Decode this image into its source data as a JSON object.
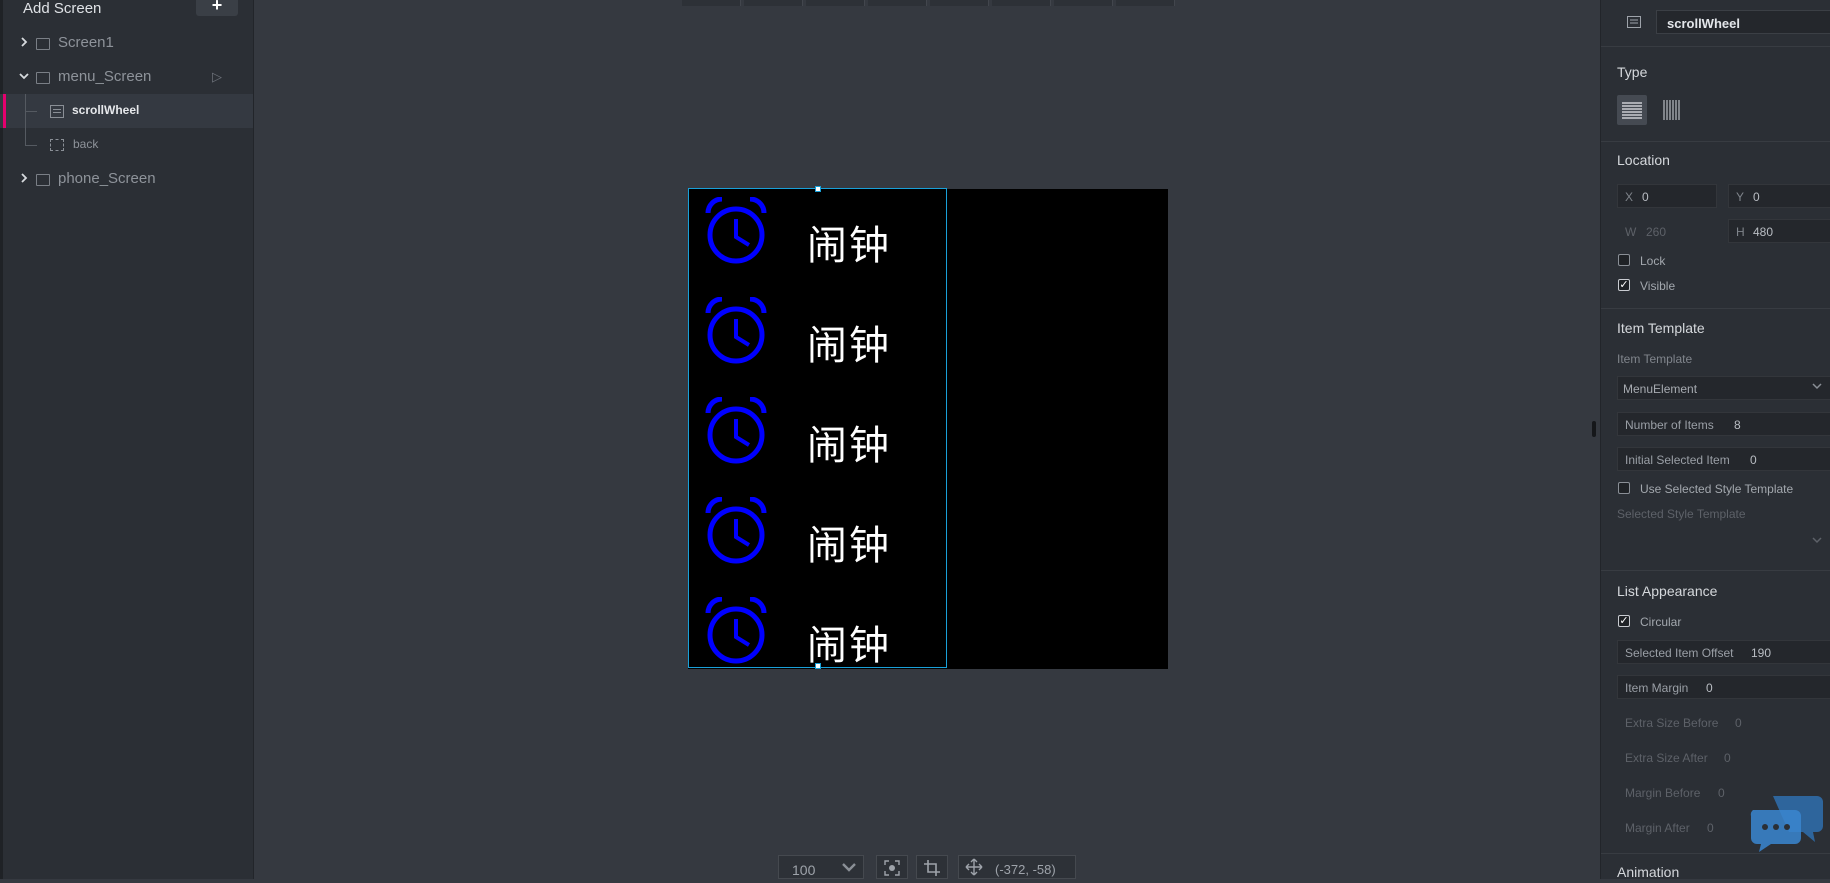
{
  "left_panel": {
    "add_screen_label": "Add Screen",
    "add_button": "+",
    "tree": {
      "screen1": "Screen1",
      "menu_screen": "menu_Screen",
      "scrollwheel": "scrollWheel",
      "back": "back",
      "phone_screen": "phone_Screen"
    }
  },
  "canvas": {
    "menu_items": [
      {
        "label": "闹钟",
        "icon": "alarm-clock-icon"
      },
      {
        "label": "闹钟",
        "icon": "alarm-clock-icon"
      },
      {
        "label": "闹钟",
        "icon": "alarm-clock-icon"
      },
      {
        "label": "闹钟",
        "icon": "alarm-clock-icon"
      },
      {
        "label": "闹钟",
        "icon": "alarm-clock-icon"
      }
    ],
    "icon_color": "#0000ff",
    "selection_color": "#19a0d8"
  },
  "bottom_bar": {
    "zoom": "100",
    "coords": "(-372, -58)"
  },
  "properties": {
    "widget_name": "scrollWheel",
    "type": {
      "title": "Type"
    },
    "location": {
      "title": "Location",
      "x_label": "X",
      "x_value": "0",
      "y_label": "Y",
      "y_value": "0",
      "w_label": "W",
      "w_value": "260",
      "h_label": "H",
      "h_value": "480",
      "lock_label": "Lock",
      "visible_label": "Visible"
    },
    "item_template": {
      "title": "Item Template",
      "sub_label": "Item Template",
      "selected": "MenuElement",
      "num_items_label": "Number of Items",
      "num_items_value": "8",
      "initial_label": "Initial Selected Item",
      "initial_value": "0",
      "use_selected_label": "Use Selected Style Template",
      "selected_style_label": "Selected Style Template"
    },
    "list_appearance": {
      "title": "List Appearance",
      "circular_label": "Circular",
      "offset_label": "Selected Item Offset",
      "offset_value": "190",
      "margin_label": "Item Margin",
      "margin_value": "0",
      "extra_before_label": "Extra Size Before",
      "extra_before_value": "0",
      "extra_after_label": "Extra Size After",
      "extra_after_value": "0",
      "margin_before_label": "Margin Before",
      "margin_before_value": "0",
      "margin_after_label": "Margin After",
      "margin_after_value": "0"
    },
    "animation": {
      "title": "Animation"
    }
  }
}
